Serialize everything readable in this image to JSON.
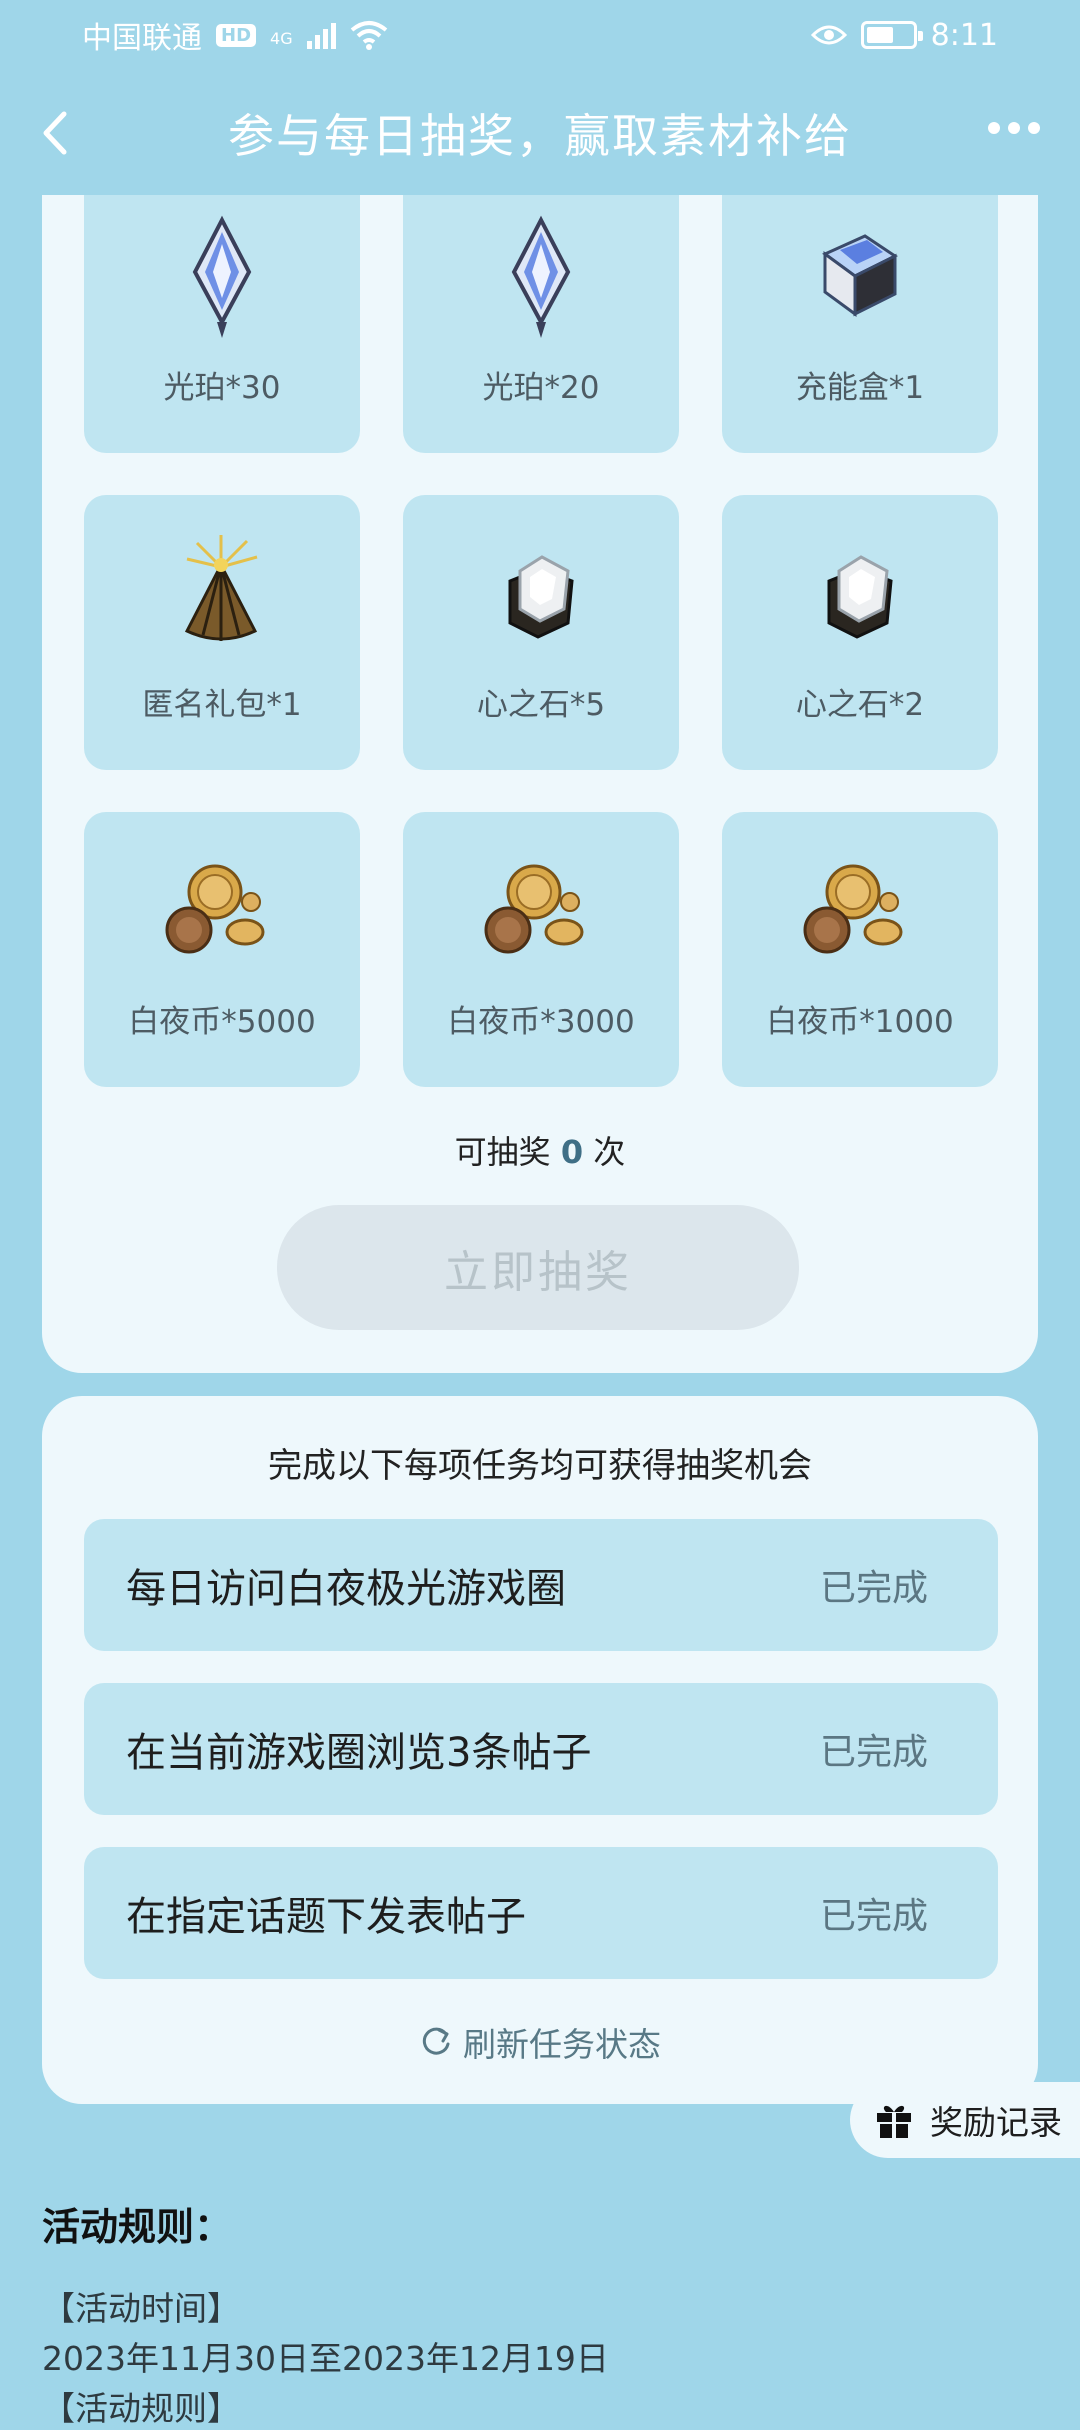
{
  "status_bar": {
    "carrier": "中国联通",
    "hd": "HD",
    "network": "4G",
    "time": "8:11",
    "battery_level": 0.6
  },
  "nav": {
    "title": "参与每日抽奖，赢取素材补给"
  },
  "prizes": [
    {
      "label": "光珀*30",
      "icon": "crystal-icon"
    },
    {
      "label": "光珀*20",
      "icon": "crystal-icon"
    },
    {
      "label": "充能盒*1",
      "icon": "charge-box-icon"
    },
    {
      "label": "匿名礼包*1",
      "icon": "gift-bag-icon"
    },
    {
      "label": "心之石*5",
      "icon": "heart-stone-icon"
    },
    {
      "label": "心之石*2",
      "icon": "heart-stone-icon"
    },
    {
      "label": "白夜币*5000",
      "icon": "coins-icon"
    },
    {
      "label": "白夜币*3000",
      "icon": "coins-icon"
    },
    {
      "label": "白夜币*1000",
      "icon": "coins-icon"
    }
  ],
  "draw": {
    "prefix": "可抽奖",
    "count": "0",
    "suffix": "次",
    "button_label": "立即抽奖"
  },
  "tasks": {
    "heading": "完成以下每项任务均可获得抽奖机会",
    "items": [
      {
        "name": "每日访问白夜极光游戏圈",
        "status": "已完成"
      },
      {
        "name": "在当前游戏圈浏览3条帖子",
        "status": "已完成"
      },
      {
        "name": "在指定话题下发表帖子",
        "status": "已完成"
      }
    ],
    "refresh_label": "刷新任务状态"
  },
  "reward_record": {
    "label": "奖励记录"
  },
  "rules": {
    "title": "活动规则：",
    "time_heading": "【活动时间】",
    "time_value": "2023年11月30日至2023年12月19日",
    "rules_heading": "【活动规则】"
  }
}
